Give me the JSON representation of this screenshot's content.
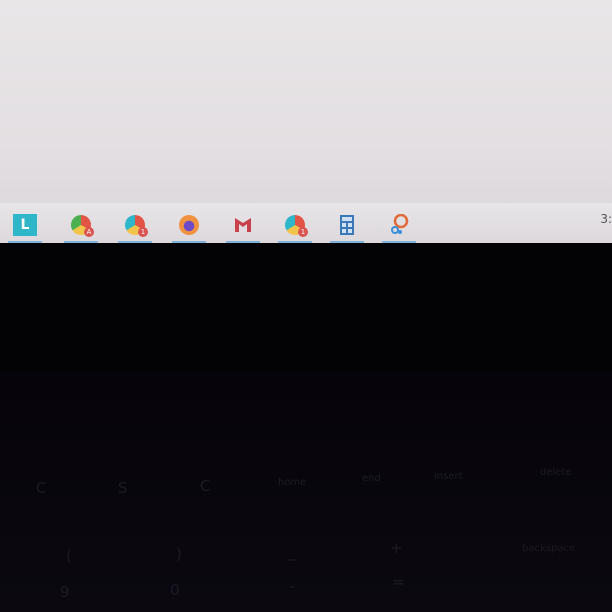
{
  "desktop": {},
  "taskbar": {
    "items": [
      {
        "name": "l-app",
        "glyph": "L",
        "color": "#2fb6c9"
      },
      {
        "name": "chrome-profile-a",
        "badge": "A"
      },
      {
        "name": "chrome-profile-1",
        "badge": "1"
      },
      {
        "name": "firefox"
      },
      {
        "name": "mcafee"
      },
      {
        "name": "chrome-profile-2",
        "badge": "1"
      },
      {
        "name": "calculator"
      },
      {
        "name": "paint-3d"
      }
    ],
    "clock_partial": "3:"
  },
  "keyboard": {
    "row1": [
      "C",
      "S",
      "C",
      "home",
      "end",
      "insert",
      "delete"
    ],
    "row2": [
      "(",
      ")",
      "_",
      "+",
      "backspace"
    ],
    "row3": [
      "9",
      "0",
      "-",
      "="
    ]
  }
}
